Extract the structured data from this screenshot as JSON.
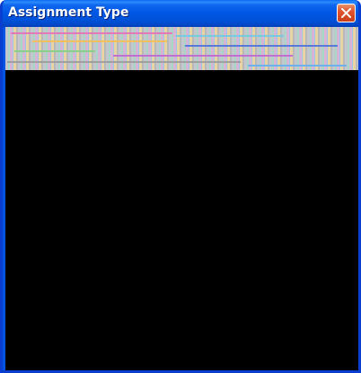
{
  "window": {
    "title": "Assignment Type",
    "close_glyph": "close-icon"
  },
  "colors": {
    "title_bar": "#0058e6",
    "close_button": "#e1532c",
    "content_background": "#000000"
  }
}
